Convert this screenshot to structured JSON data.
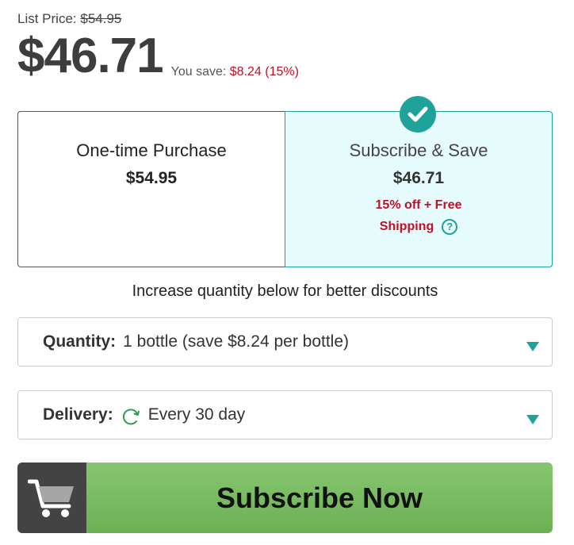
{
  "pricing": {
    "list_label": "List Price:",
    "list_price": "$54.95",
    "current_price": "$46.71",
    "you_save_label": "You save:",
    "you_save_amount": "$8.24 (15%)"
  },
  "options": {
    "onetime": {
      "title": "One-time Purchase",
      "price": "$54.95"
    },
    "subscribe": {
      "title": "Subscribe & Save",
      "price": "$46.71",
      "promo_line1": "15% off + Free",
      "promo_line2": "Shipping",
      "help_glyph": "?",
      "selected": true
    }
  },
  "hint": "Increase quantity below for better discounts",
  "quantity": {
    "label": "Quantity:",
    "value": "1 bottle (save $8.24 per bottle)"
  },
  "delivery": {
    "label": "Delivery:",
    "value": "Every 30 day",
    "icon": "refresh-icon"
  },
  "cta": {
    "label": "Subscribe Now",
    "icon": "cart-icon"
  },
  "colors": {
    "accent_teal": "#1fa29a",
    "sale_red": "#c0102a",
    "button_green": "#6cb054",
    "cart_box": "#434343",
    "selected_bg": "#e6fbfb"
  }
}
